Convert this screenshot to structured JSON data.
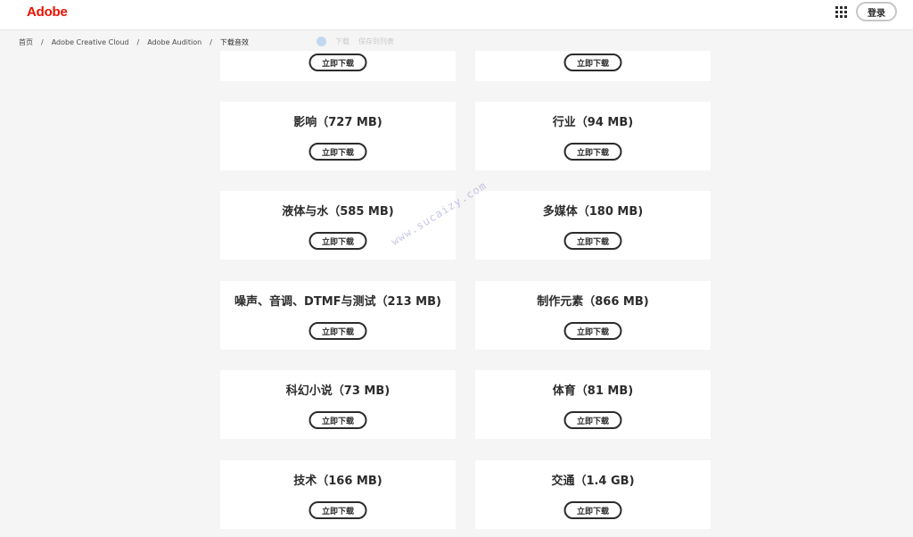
{
  "header": {
    "logo": "Adobe",
    "apps_icon": "grid-9-icon",
    "signin_label": "登录"
  },
  "breadcrumb": {
    "items": [
      "首页",
      "Adobe Creative Cloud",
      "Adobe Audition"
    ],
    "separator": "/",
    "current": "下载音效"
  },
  "ghost_toolbar": {
    "items": [
      "下载",
      "保存到列表"
    ]
  },
  "download_label": "立即下载",
  "cards": [
    {
      "title": ""
    },
    {
      "title": ""
    },
    {
      "title": "影响（727 MB)"
    },
    {
      "title": "行业（94 MB)"
    },
    {
      "title": "液体与水（585 MB)"
    },
    {
      "title": "多媒体（180 MB)"
    },
    {
      "title": "噪声、音调、DTMF与测试（213 MB)"
    },
    {
      "title": "制作元素（866 MB)"
    },
    {
      "title": "科幻小说（73 MB)"
    },
    {
      "title": "体育（81 MB)"
    },
    {
      "title": "技术（166 MB)"
    },
    {
      "title": "交通（1.4 GB)"
    }
  ],
  "watermark": "www.sucaizy.com",
  "colors": {
    "brand": "#eb1000",
    "background": "#f5f5f5",
    "card": "#ffffff",
    "text": "#2c2c2c"
  }
}
